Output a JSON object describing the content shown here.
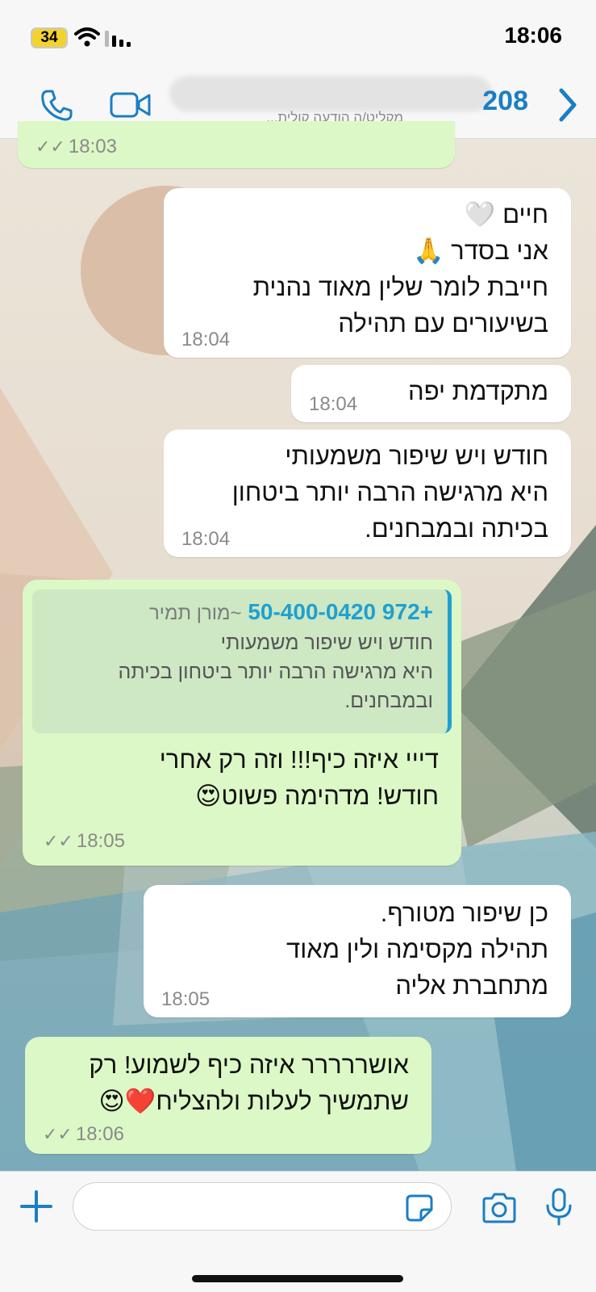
{
  "status_bar": {
    "battery": "34",
    "time": "18:06"
  },
  "header": {
    "subtitle": "מקליט/ה הודעה קולית...",
    "unread_count": "208",
    "icons": [
      "phone-icon",
      "video-icon",
      "back-chevron-icon"
    ]
  },
  "messages": [
    {
      "direction": "outgoing",
      "lines": [],
      "time": "18:03",
      "read": true
    },
    {
      "direction": "incoming",
      "lines": [
        "חיים 🤍",
        "אני בסדר 🙏",
        "חייבת לומר שלין מאוד נהנית",
        "בשיעורים עם תהילה"
      ],
      "time": "18:04"
    },
    {
      "direction": "incoming",
      "lines": [
        "מתקדמת יפה"
      ],
      "time": "18:04"
    },
    {
      "direction": "incoming",
      "lines": [
        "חודש ויש שיפור משמעותי",
        "היא מרגישה הרבה יותר ביטחון",
        "בכיתה ובמבחנים."
      ],
      "time": "18:04"
    },
    {
      "direction": "outgoing",
      "quote": {
        "phone": "+972 50-400-0420",
        "name": "~מורן תמיר",
        "lines": [
          "חודש ויש שיפור משמעותי",
          "היא מרגישה הרבה יותר ביטחון בכיתה",
          "ובמבחנים."
        ]
      },
      "lines": [
        "דייי איזה כיף!!! וזה רק אחרי",
        "חודש! מדהימה פשוט😍"
      ],
      "time": "18:05",
      "read": true
    },
    {
      "direction": "incoming",
      "lines": [
        "כן שיפור מטורף.",
        "תהילה מקסימה ולין מאוד",
        "מתחברת אליה"
      ],
      "time": "18:05"
    },
    {
      "direction": "outgoing",
      "lines": [
        "אושררררר איזה כיף לשמוע! רק",
        "שתמשיך לעלות ולהצליח❤️😍"
      ],
      "time": "18:06",
      "read": true
    }
  ],
  "input_bar": {
    "placeholder": "",
    "icons": [
      "plus-icon",
      "sticker-icon",
      "camera-icon",
      "microphone-icon"
    ]
  },
  "colors": {
    "accent": "#1a7ec4",
    "outgoing_bubble": "#dcf8c6",
    "incoming_bubble": "#ffffff",
    "quote_bar": "#1fa0d0"
  }
}
